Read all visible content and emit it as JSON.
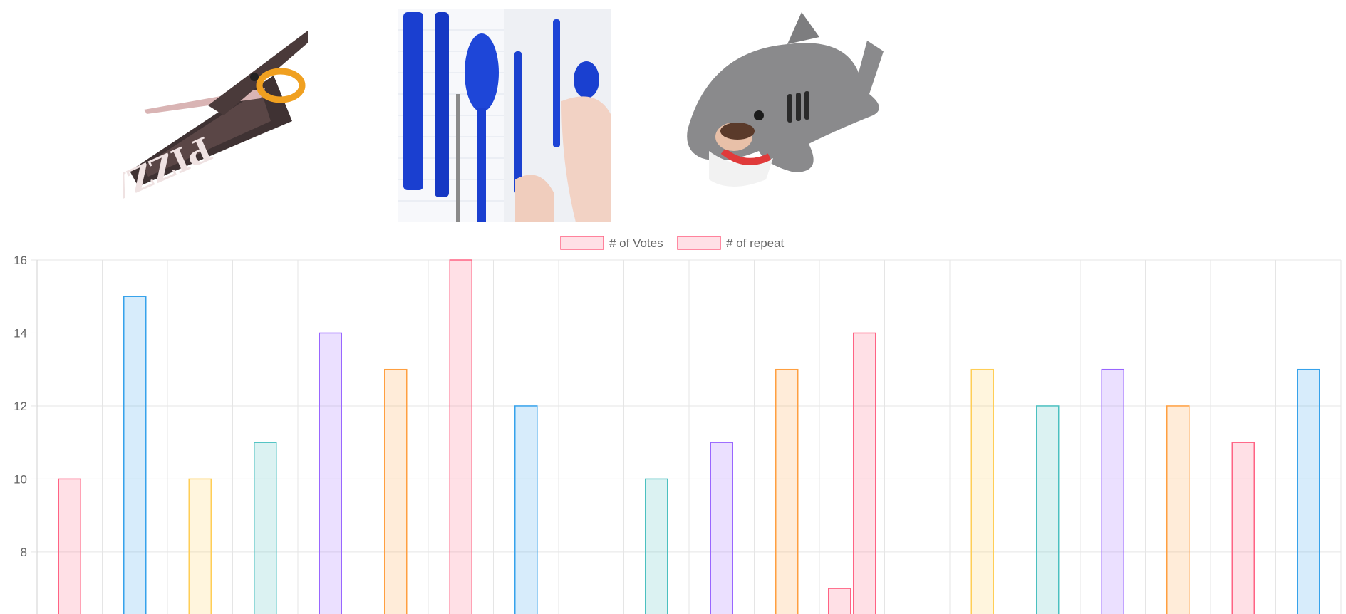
{
  "images": [
    {
      "name": "pizza-scissors-image"
    },
    {
      "name": "blue-cutlery-pens-image"
    },
    {
      "name": "shark-sleeping-bag-image"
    }
  ],
  "chart_data": {
    "type": "bar",
    "title": "",
    "xlabel": "",
    "ylabel": "",
    "ylim": [
      6.3,
      16
    ],
    "y_ticks": [
      "16",
      "14",
      "12",
      "10",
      "8"
    ],
    "grid": true,
    "legend_position": "top",
    "legend": [
      {
        "label": "# of Votes",
        "color": "#ff6384"
      },
      {
        "label": "# of repeat",
        "color": "#ff6384"
      }
    ],
    "categories": 20,
    "series": [
      {
        "name": "# of Votes",
        "values": [
          10,
          15,
          10,
          11,
          14,
          13,
          16,
          12,
          null,
          10,
          11,
          13,
          7,
          null,
          13,
          12,
          13,
          12,
          11,
          13
        ]
      },
      {
        "name": "# of repeat",
        "values": [
          null,
          null,
          null,
          null,
          null,
          null,
          null,
          null,
          null,
          null,
          null,
          null,
          14,
          null,
          null,
          null,
          null,
          null,
          null,
          null
        ]
      }
    ],
    "palette": [
      "#ff6384",
      "#36a2eb",
      "#ffce56",
      "#4bc0c0",
      "#9966ff",
      "#ff9f40"
    ]
  }
}
